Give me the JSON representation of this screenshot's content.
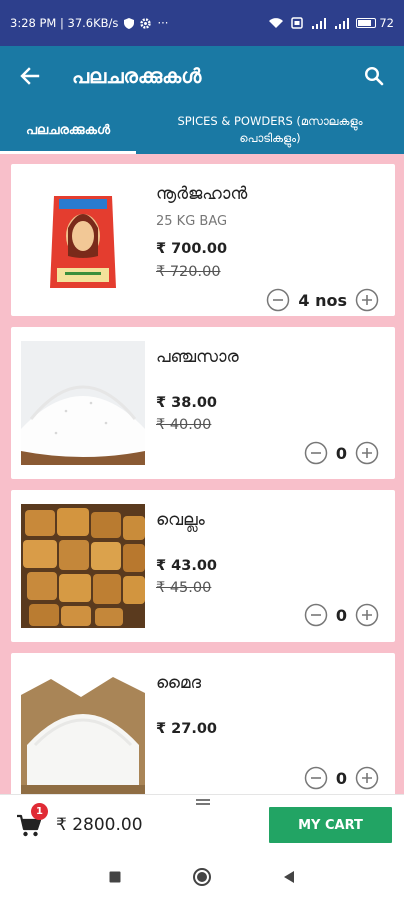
{
  "status_bar": {
    "time_info": "3:28 PM | 37.6KB/s",
    "more": "···",
    "battery": "72"
  },
  "app_bar": {
    "title": "പലചരക്കുകൾ"
  },
  "tabs": [
    {
      "label": "പലചരക്കുകൾ",
      "selected": true
    },
    {
      "label_line1": "SPICES & POWDERS (മസാലകളും",
      "label_line2": "പൊടികളും)",
      "selected": false
    }
  ],
  "products": [
    {
      "name": "നൂർജഹാൻ",
      "pack": "25 KG BAG",
      "price": "₹ 700.00",
      "mrp": "₹ 720.00",
      "qty": "4 nos"
    },
    {
      "name": "പഞ്ചസാര",
      "price": "₹ 38.00",
      "mrp": "₹ 40.00",
      "qty": "0"
    },
    {
      "name": "വെല്ലം",
      "price": "₹ 43.00",
      "mrp": "₹ 45.00",
      "qty": "0"
    },
    {
      "name": "മൈദ",
      "price": "₹ 27.00",
      "qty": "0"
    }
  ],
  "cart": {
    "badge": "1",
    "total": "₹ 2800.00",
    "button_label": "MY CART"
  },
  "colors": {
    "status_bar": "#2d3f8c",
    "app_bar": "#1a79a4",
    "list_background": "#f8bfca",
    "cart_button": "#22a464",
    "badge": "#e02b35"
  }
}
